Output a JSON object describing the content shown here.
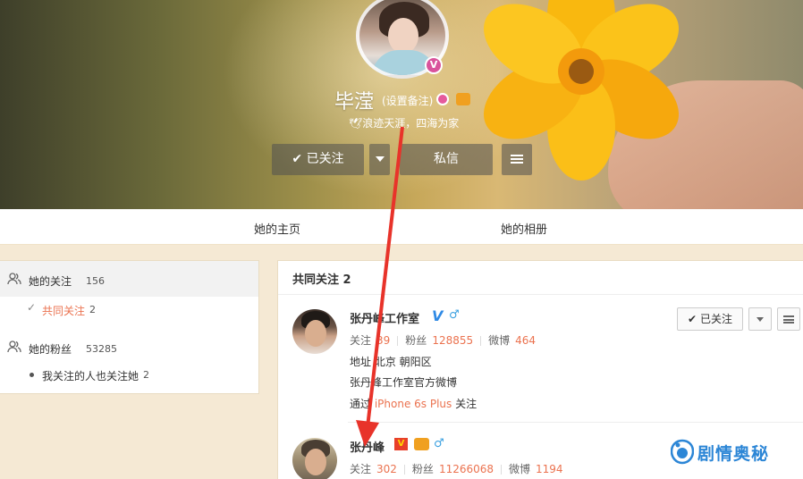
{
  "profile": {
    "name": "毕滢",
    "remark": "(设置备注)",
    "bio": "浪迹天涯，四海为家",
    "verified_badge": "V",
    "buttons": {
      "follow": "已关注",
      "message": "私信"
    }
  },
  "tabs": [
    "她的主页",
    "她的相册"
  ],
  "sidebar": {
    "following": {
      "label": "她的关注",
      "count": "156"
    },
    "mutual": {
      "label": "共同关注",
      "count": "2"
    },
    "fans": {
      "label": "她的粉丝",
      "count": "53285"
    },
    "mutual_fans": {
      "label": "我关注的人也关注她",
      "count": "2"
    }
  },
  "main": {
    "title": "共同关注 2",
    "users": [
      {
        "name": "张丹峰工作室",
        "verified": "V",
        "gender": "♂",
        "follow_label": "关注",
        "follow_count": "39",
        "fans_label": "粉丝",
        "fans_count": "128855",
        "weibo_label": "微博",
        "weibo_count": "464",
        "address_label": "地址",
        "address": "北京 朝阳区",
        "description": "张丹峰工作室官方微博",
        "via_prefix": "通过",
        "via_device": "iPhone 6s Plus",
        "via_suffix": "关注",
        "button_label": "已关注"
      },
      {
        "name": "张丹峰",
        "verified": "V",
        "gender": "♂",
        "follow_label": "关注",
        "follow_count": "302",
        "fans_label": "粉丝",
        "fans_count": "11266068",
        "weibo_label": "微博",
        "weibo_count": "1194"
      }
    ]
  },
  "watermark": "剧情奥秘",
  "colors": {
    "accent": "#eb7350",
    "verified_blue": "#2f8ae5",
    "arrow_red": "#e8332a"
  },
  "icons": [
    "checkmark-icon",
    "caret-down-icon",
    "menu-icon",
    "users-icon",
    "male-icon",
    "verified-icon",
    "vip-icon",
    "arrow-annotation"
  ]
}
